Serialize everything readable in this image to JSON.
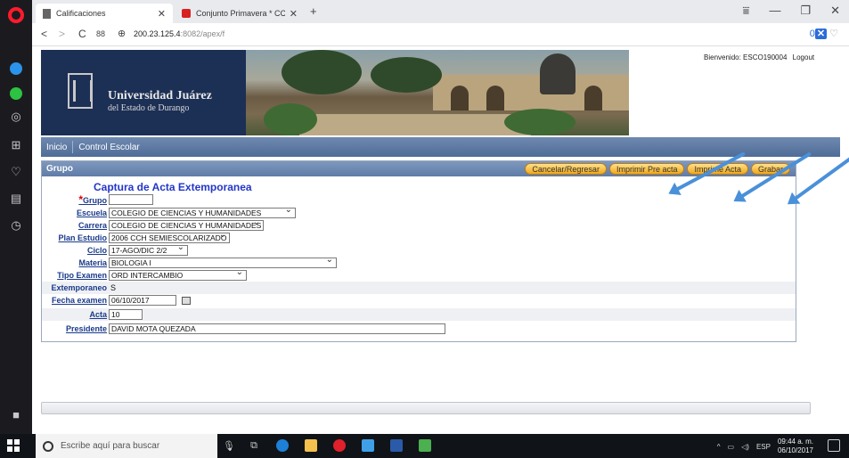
{
  "browser": {
    "tabs": [
      {
        "label": "Calificaciones",
        "close": "✕"
      },
      {
        "label": "Conjunto Primavera * CCH",
        "close": "✕"
      }
    ],
    "new_tab": "+",
    "url_host": "200.23.125.4",
    "url_rest": ":8082/apex/f",
    "window_controls": [
      "⩸",
      "—",
      "❐",
      "✕"
    ],
    "nav": {
      "back": "<",
      "forward": ">",
      "reload": "C",
      "grid": "88"
    }
  },
  "header": {
    "university_line1": "Universidad Juárez",
    "university_line2": "del Estado de Durango",
    "welcome": "Bienvenido: ESCO190004",
    "logout": "Logout"
  },
  "navbar": {
    "items": [
      "Inicio",
      "Control Escolar"
    ]
  },
  "region": {
    "title": "Grupo",
    "buttons": [
      "Cancelar/Regresar",
      "Imprimir Pre acta",
      "Imprime Acta",
      "Grabar"
    ],
    "form_title": "Captura de Acta Extemporanea"
  },
  "form": {
    "grupo": {
      "label": "Grupo",
      "required": "*",
      "value": ""
    },
    "escuela": {
      "label": "Escuela",
      "value": "COLEGIO DE CIENCIAS Y HUMANIDADES"
    },
    "carrera": {
      "label": "Carrera",
      "value": "COLEGIO DE CIENCIAS Y HUMANIDADES"
    },
    "plan_estudio": {
      "label": "Plan Estudio",
      "value": "2006 CCH SEMIESCOLARIZADO"
    },
    "ciclo": {
      "label": "Ciclo",
      "value": "17-AGO/DIC 2/2"
    },
    "materia": {
      "label": "Materia",
      "value": "BIOLOGIA I"
    },
    "tipo_examen": {
      "label": "Tipo Examen",
      "value": "ORD INTERCAMBIO"
    },
    "extemporaneo": {
      "label": "Extemporaneo",
      "value": "S"
    },
    "fecha_examen": {
      "label": "Fecha examen",
      "value": "06/10/2017"
    },
    "acta": {
      "label": "Acta",
      "value": "10"
    },
    "presidente": {
      "label": "Presidente",
      "value": "DAVID MOTA QUEZADA"
    }
  },
  "taskbar": {
    "search_placeholder": "Escribe aquí para buscar",
    "lang": "ESP",
    "time": "09:44 a. m.",
    "date": "06/10/2017"
  },
  "colors": {
    "accent": "#4f6d98",
    "button": "#f0a81c",
    "title": "#2336c8",
    "arrow": "#4a90d9"
  }
}
